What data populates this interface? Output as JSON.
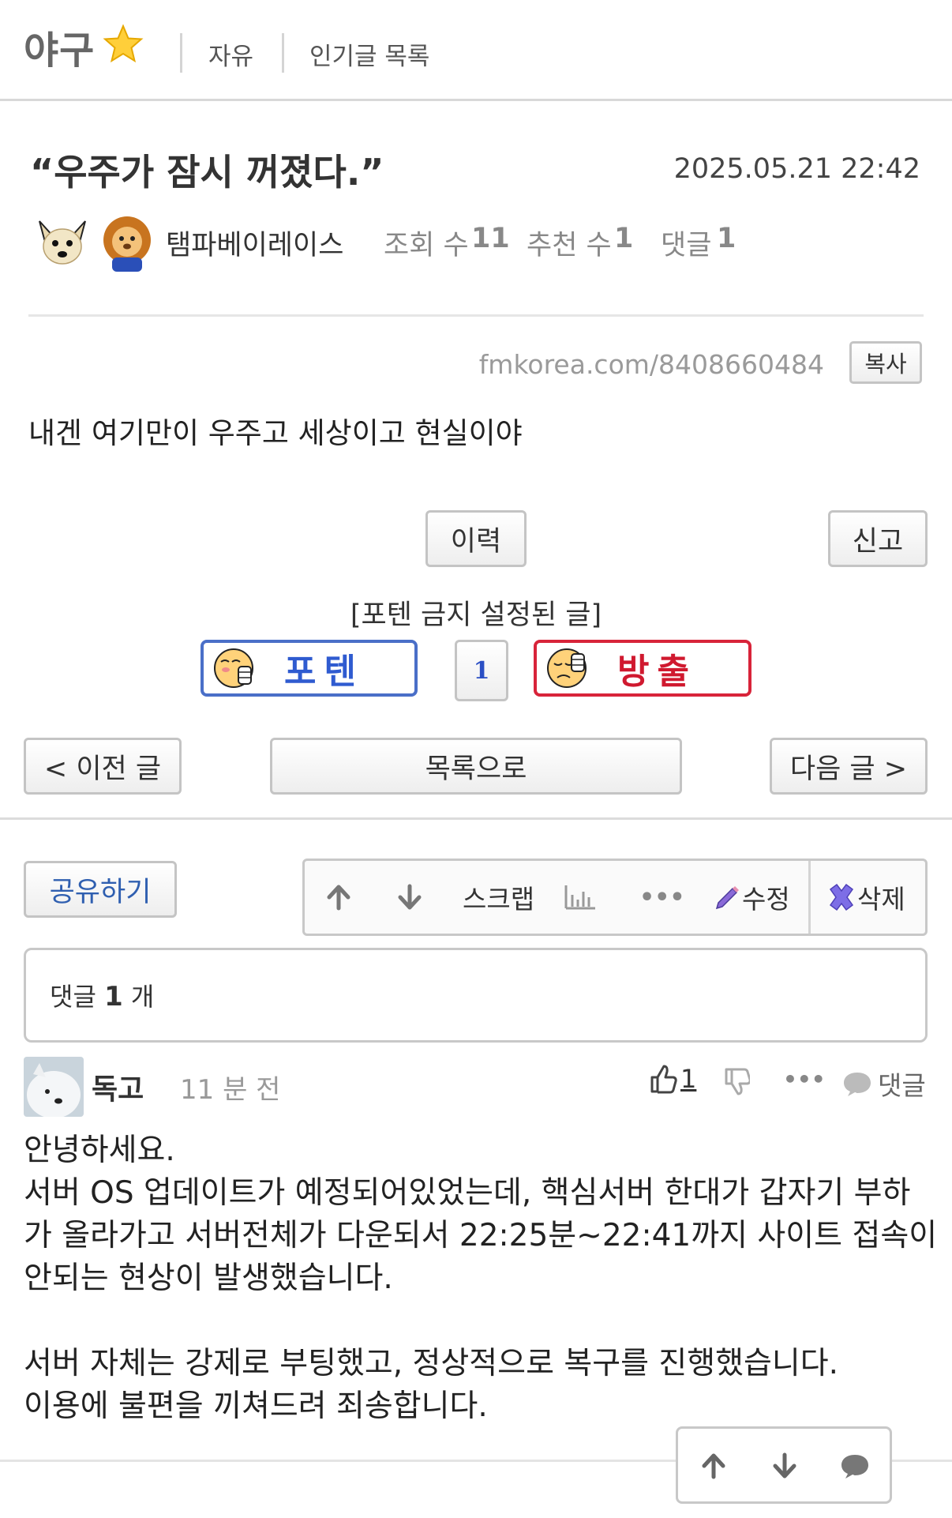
{
  "header": {
    "board_name": "야구",
    "links": [
      "자유",
      "인기글 목록"
    ]
  },
  "post": {
    "title": "“우주가 잠시 꺼졌다.”",
    "date": "2025.05.21 22:42",
    "author": "탬파베이레이스",
    "views_label": "조회 수",
    "views": "11",
    "recommend_label": "추천 수",
    "recommend": "1",
    "comments_label": "댓글",
    "comments": "1",
    "url": "fmkorea.com/8408660484",
    "copy_label": "복사",
    "body": "내겐 여기만이 우주고 세상이고 현실이야",
    "history_label": "이력",
    "report_label": "신고",
    "vote_caption": "[포텐 금지 설정된 글]",
    "upvote_label": "포텐",
    "vote_count": "1",
    "downvote_label": "방출"
  },
  "nav": {
    "prev_label": "< 이전 글",
    "list_label": "목록으로",
    "next_label": "다음 글 >"
  },
  "actions": {
    "share_label": "공유하기",
    "scrap_label": "스크랩",
    "edit_label": "수정",
    "delete_label": "삭제"
  },
  "comment_summary": {
    "prefix": "댓글",
    "count": "1",
    "suffix": "개"
  },
  "comment": {
    "author": "독고",
    "time": "11 분 전",
    "likes": "1",
    "reply_label": "댓글",
    "lines": [
      "안녕하세요.",
      "서버 OS 업데이트가 예정되어있었는데, 핵심서버 한대가 갑자기 부하",
      "가 올라가고 서버전체가 다운되서 22:25분~22:41까지 사이트 접속이",
      "안되는 현상이 발생했습니다.",
      "",
      "서버 자체는 강제로 부팅했고, 정상적으로 복구를 진행했습니다.",
      "이용에 불편을 끼쳐드려 죄송합니다."
    ]
  },
  "colors": {
    "upvote_border": "#4a6fc8",
    "upvote_text": "#2f5bd0",
    "downvote_border": "#d8243a",
    "downvote_text": "#d0192f",
    "vote_count": "#2b4fc4",
    "share_text": "#2f5fb0"
  }
}
